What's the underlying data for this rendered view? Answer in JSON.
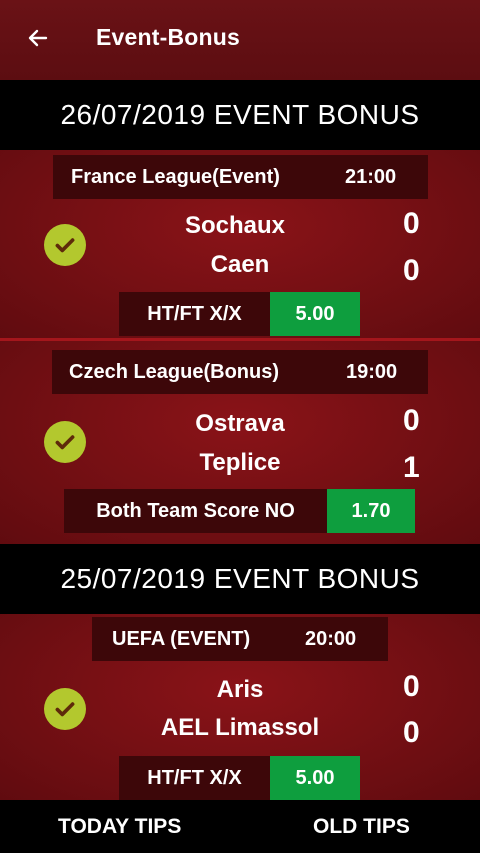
{
  "appbar": {
    "title": "Event-Bonus",
    "back_icon": "arrow-left-icon"
  },
  "sections": [
    {
      "date_title": "26/07/2019 EVENT BONUS",
      "matches": [
        {
          "league": "France League(Event)",
          "time": "21:00",
          "home": "Sochaux",
          "away": "Caen",
          "home_score": "0",
          "away_score": "0",
          "pick": "HT/FT X/X",
          "odd": "5.00",
          "status_icon": "check-circle-icon"
        },
        {
          "league": "Czech League(Bonus)",
          "time": "19:00",
          "home": "Ostrava",
          "away": "Teplice",
          "home_score": "0",
          "away_score": "1",
          "pick": "Both Team Score NO",
          "odd": "1.70",
          "status_icon": "check-circle-icon"
        }
      ]
    },
    {
      "date_title": "25/07/2019 EVENT BONUS",
      "matches": [
        {
          "league": "UEFA (EVENT)",
          "time": "20:00",
          "home": "Aris",
          "away": "AEL Limassol",
          "home_score": "0",
          "away_score": "0",
          "pick": "HT/FT X/X",
          "odd": "5.00",
          "status_icon": "check-circle-icon"
        }
      ]
    }
  ],
  "bottom_nav": {
    "today": "TODAY TIPS",
    "old": "OLD TIPS"
  },
  "colors": {
    "appbar": "#5c0d11",
    "card": "#7a1015",
    "odd_green": "#0e9e3e",
    "check_green": "#b3c82e",
    "date_bar": "#000000"
  }
}
